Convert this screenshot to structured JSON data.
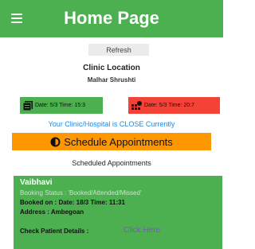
{
  "appbar": {
    "title": "Home Page",
    "menu_icon": "hamburger-menu-icon"
  },
  "refresh_label": "Refresh",
  "clinic": {
    "heading": "Clinic Location",
    "name": "Malhar Shrushti"
  },
  "badges": {
    "left": {
      "text": "Date: 5/3  Time: 15:3",
      "icon": "calendar-list-icon",
      "color": "#4caf50"
    },
    "right": {
      "text": "Date: 5/3  Time: 20:7",
      "icon": "grid-alert-icon",
      "color": "#f44336"
    }
  },
  "clinic_status": "Your Clinic/Hospital is CLOSE Currently",
  "schedule_button": {
    "label": "Schedule Appointments",
    "icon": "half-circle-icon",
    "color": "#ff9800"
  },
  "scheduled_heading": "Scheduled Appointments",
  "appointment": {
    "name": "Vaibhavi",
    "status": "Booking Status : 'Booked/Attended/Missed'",
    "booked_on": "Booked on : Date: 18/3  Time: 11:31",
    "address": "Address : Ambegoan",
    "check_label": "Check Patient Details :",
    "link_label": "Click Here"
  },
  "colors": {
    "accent": "#4caf50",
    "link": "#7e57c2",
    "status_text": "#1e88e5"
  }
}
